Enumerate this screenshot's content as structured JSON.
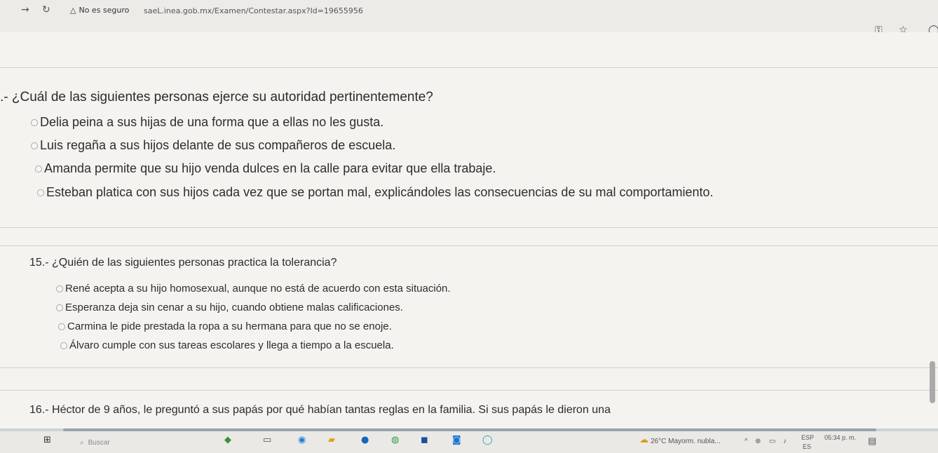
{
  "browser": {
    "security_label": "No es seguro",
    "url": "saeL.inea.gob.mx/Examen/Contestar.aspx?Id=19655956"
  },
  "questions": [
    {
      "title": ".- ¿Cuál de las siguientes personas ejerce su autoridad pertinentemente?",
      "options": [
        "Delia peina a sus hijas de una forma que a ellas no les gusta.",
        "Luis regaña a sus hijos delante de sus compañeros de escuela.",
        "Amanda permite que su hijo venda dulces en la calle para evitar que ella trabaje.",
        "Esteban platica con sus hijos cada vez que se portan mal, explicándoles las consecuencias de su mal comportamiento."
      ]
    },
    {
      "title": "15.- ¿Quién de las siguientes personas practica la tolerancia?",
      "options": [
        "René acepta a su hijo homosexual, aunque no está de acuerdo con esta situación.",
        "Esperanza deja sin cenar a su hijo, cuando obtiene malas calificaciones.",
        "Carmina le pide prestada la ropa a su hermana para que no se enoje.",
        "Álvaro cumple con sus tareas escolares y llega a tiempo a la escuela."
      ]
    },
    {
      "title": "16.- Héctor de 9 años, le preguntó a sus papás por qué habían tantas reglas en la familia. Si sus papás le dieron una"
    }
  ],
  "taskbar": {
    "search_placeholder": "Buscar",
    "weather": "26°C  Mayorm. nubla...",
    "lang_top": "ESP",
    "lang_bottom": "ES",
    "time": "05:34 p. m."
  }
}
